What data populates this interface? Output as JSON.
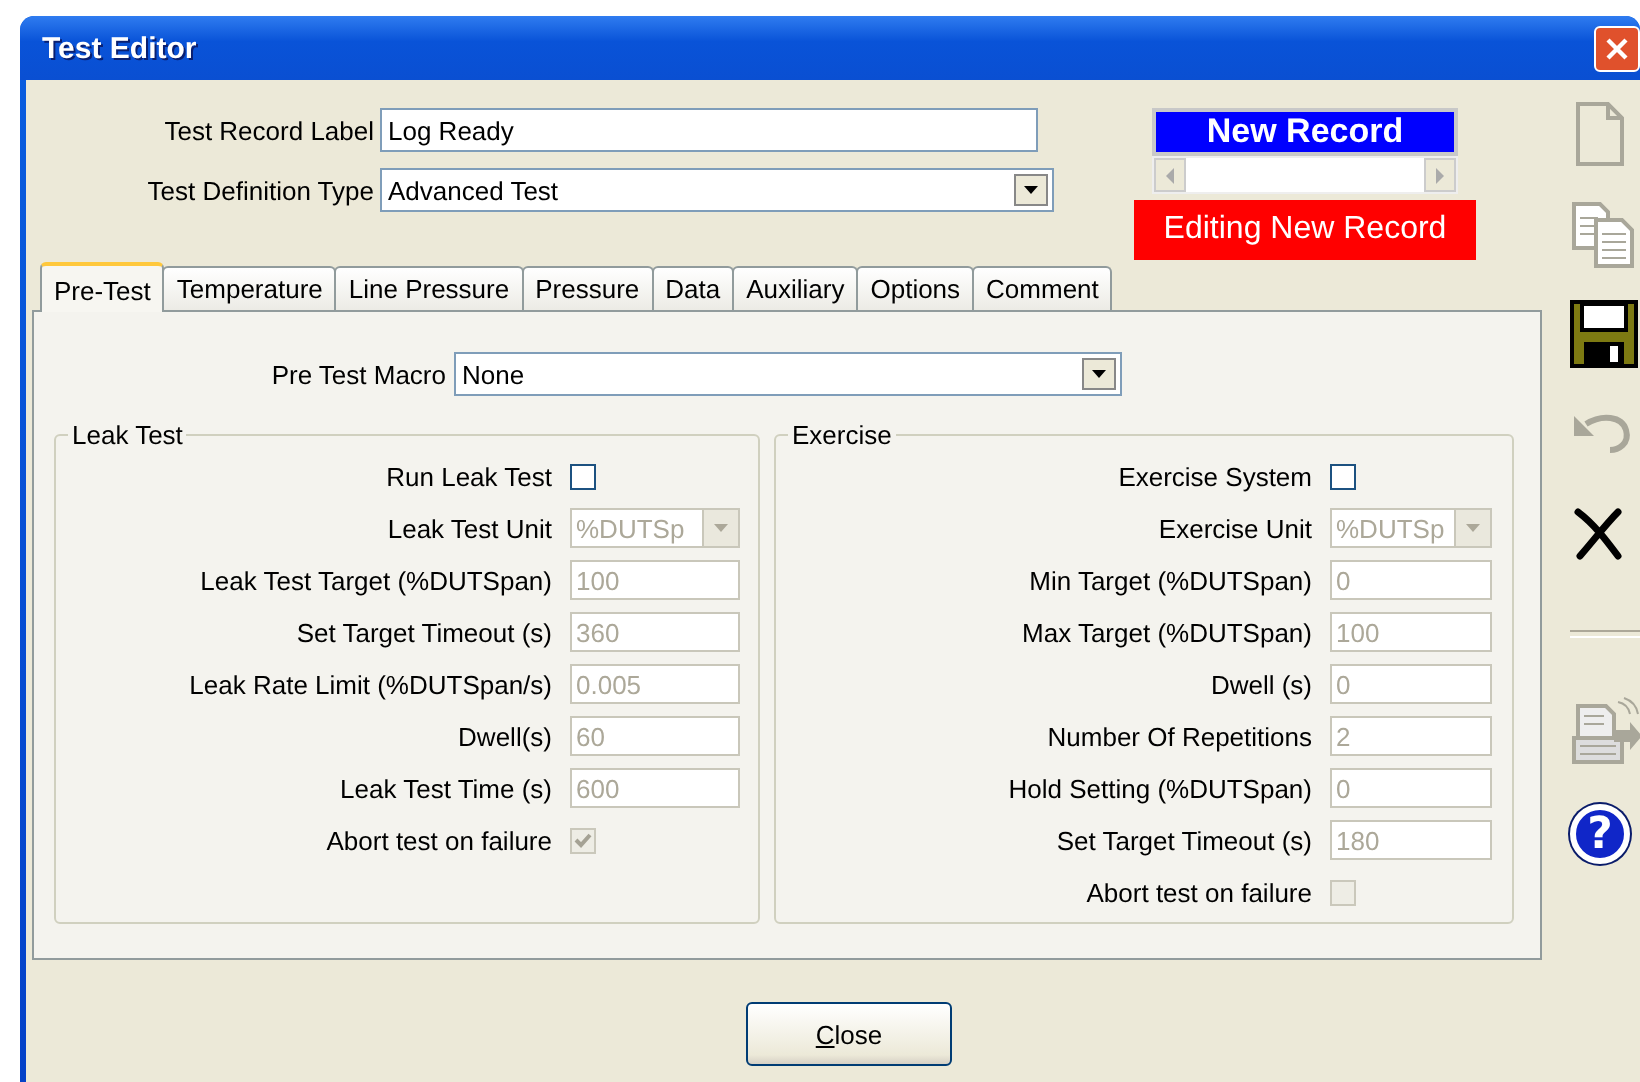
{
  "window": {
    "title": "Test Editor"
  },
  "header": {
    "fields": [
      {
        "label": "Test Record Label",
        "kind": "text",
        "value": "Log Ready"
      },
      {
        "label": "Test Definition Type",
        "kind": "combo",
        "value": "Advanced Test"
      }
    ],
    "record": {
      "title": "New Record",
      "status": "Editing New Record"
    }
  },
  "tabs": [
    {
      "label": "Pre-Test",
      "selected": true
    },
    {
      "label": "Temperature",
      "selected": false
    },
    {
      "label": "Line Pressure",
      "selected": false
    },
    {
      "label": "Pressure",
      "selected": false
    },
    {
      "label": "Data",
      "selected": false
    },
    {
      "label": "Auxiliary",
      "selected": false
    },
    {
      "label": "Options",
      "selected": false
    },
    {
      "label": "Comment",
      "selected": false
    }
  ],
  "pre_test": {
    "macro": {
      "label": "Pre Test Macro",
      "value": "None"
    },
    "groups": [
      {
        "title": "Leak Test",
        "rows": [
          {
            "label": "Run Leak Test",
            "kind": "checkbox",
            "checked": false,
            "disabled": false
          },
          {
            "label": "Leak Test Unit",
            "kind": "combo",
            "value": "%DUTSp",
            "disabled": true
          },
          {
            "label": "Leak Test Target (%DUTSpan)",
            "kind": "text",
            "value": "100",
            "disabled": true
          },
          {
            "label": "Set Target Timeout (s)",
            "kind": "text",
            "value": "360",
            "disabled": true
          },
          {
            "label": "Leak Rate Limit (%DUTSpan/s)",
            "kind": "text",
            "value": "0.005",
            "disabled": true
          },
          {
            "label": "Dwell(s)",
            "kind": "text",
            "value": "60",
            "disabled": true
          },
          {
            "label": "Leak Test Time (s)",
            "kind": "text",
            "value": "600",
            "disabled": true
          },
          {
            "label": "Abort test on failure",
            "kind": "checkbox",
            "checked": true,
            "disabled": true
          }
        ]
      },
      {
        "title": "Exercise",
        "rows": [
          {
            "label": "Exercise System",
            "kind": "checkbox",
            "checked": false,
            "disabled": false
          },
          {
            "label": "Exercise Unit",
            "kind": "combo",
            "value": "%DUTSp",
            "disabled": true
          },
          {
            "label": "Min Target (%DUTSpan)",
            "kind": "text",
            "value": "0",
            "disabled": true
          },
          {
            "label": "Max Target (%DUTSpan)",
            "kind": "text",
            "value": "100",
            "disabled": true
          },
          {
            "label": "Dwell (s)",
            "kind": "text",
            "value": "0",
            "disabled": true
          },
          {
            "label": "Number Of Repetitions",
            "kind": "text",
            "value": "2",
            "disabled": true
          },
          {
            "label": "Hold Setting (%DUTSpan)",
            "kind": "text",
            "value": "0",
            "disabled": true
          },
          {
            "label": "Set Target Timeout (s)",
            "kind": "text",
            "value": "180",
            "disabled": true
          },
          {
            "label": "Abort test on failure",
            "kind": "checkbox",
            "checked": false,
            "disabled": true
          }
        ]
      }
    ]
  },
  "buttons": [
    {
      "label": "Close",
      "mnemonic_underlined": true
    }
  ],
  "toolbar": [
    {
      "kind": "new",
      "disabled": true
    },
    {
      "kind": "copy",
      "disabled": true
    },
    {
      "kind": "save",
      "disabled": false
    },
    {
      "kind": "undo",
      "disabled": true
    },
    {
      "kind": "delete",
      "disabled": false
    },
    {
      "kind": "separator"
    },
    {
      "kind": "send",
      "disabled": true
    },
    {
      "kind": "help",
      "disabled": false,
      "glyph": "?"
    }
  ]
}
